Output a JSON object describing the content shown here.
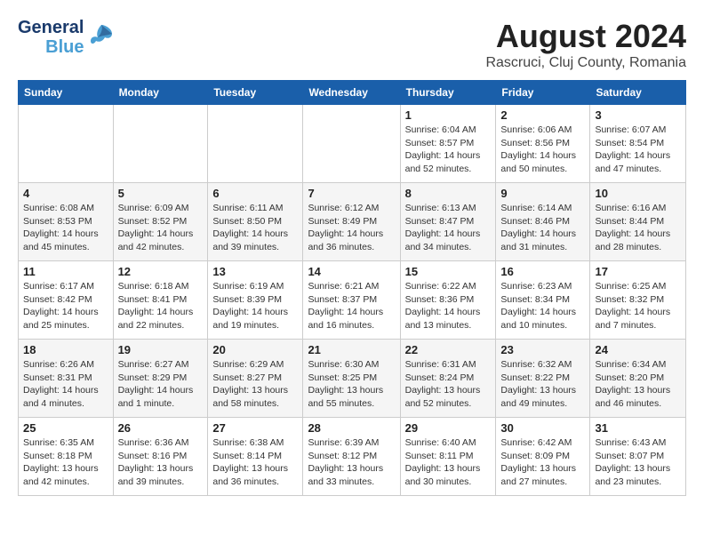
{
  "logo": {
    "line1": "General",
    "line2": "Blue"
  },
  "title": "August 2024",
  "location": "Rascruci, Cluj County, Romania",
  "days_of_week": [
    "Sunday",
    "Monday",
    "Tuesday",
    "Wednesday",
    "Thursday",
    "Friday",
    "Saturday"
  ],
  "weeks": [
    [
      {
        "day": "",
        "info": ""
      },
      {
        "day": "",
        "info": ""
      },
      {
        "day": "",
        "info": ""
      },
      {
        "day": "",
        "info": ""
      },
      {
        "day": "1",
        "info": "Sunrise: 6:04 AM\nSunset: 8:57 PM\nDaylight: 14 hours\nand 52 minutes."
      },
      {
        "day": "2",
        "info": "Sunrise: 6:06 AM\nSunset: 8:56 PM\nDaylight: 14 hours\nand 50 minutes."
      },
      {
        "day": "3",
        "info": "Sunrise: 6:07 AM\nSunset: 8:54 PM\nDaylight: 14 hours\nand 47 minutes."
      }
    ],
    [
      {
        "day": "4",
        "info": "Sunrise: 6:08 AM\nSunset: 8:53 PM\nDaylight: 14 hours\nand 45 minutes."
      },
      {
        "day": "5",
        "info": "Sunrise: 6:09 AM\nSunset: 8:52 PM\nDaylight: 14 hours\nand 42 minutes."
      },
      {
        "day": "6",
        "info": "Sunrise: 6:11 AM\nSunset: 8:50 PM\nDaylight: 14 hours\nand 39 minutes."
      },
      {
        "day": "7",
        "info": "Sunrise: 6:12 AM\nSunset: 8:49 PM\nDaylight: 14 hours\nand 36 minutes."
      },
      {
        "day": "8",
        "info": "Sunrise: 6:13 AM\nSunset: 8:47 PM\nDaylight: 14 hours\nand 34 minutes."
      },
      {
        "day": "9",
        "info": "Sunrise: 6:14 AM\nSunset: 8:46 PM\nDaylight: 14 hours\nand 31 minutes."
      },
      {
        "day": "10",
        "info": "Sunrise: 6:16 AM\nSunset: 8:44 PM\nDaylight: 14 hours\nand 28 minutes."
      }
    ],
    [
      {
        "day": "11",
        "info": "Sunrise: 6:17 AM\nSunset: 8:42 PM\nDaylight: 14 hours\nand 25 minutes."
      },
      {
        "day": "12",
        "info": "Sunrise: 6:18 AM\nSunset: 8:41 PM\nDaylight: 14 hours\nand 22 minutes."
      },
      {
        "day": "13",
        "info": "Sunrise: 6:19 AM\nSunset: 8:39 PM\nDaylight: 14 hours\nand 19 minutes."
      },
      {
        "day": "14",
        "info": "Sunrise: 6:21 AM\nSunset: 8:37 PM\nDaylight: 14 hours\nand 16 minutes."
      },
      {
        "day": "15",
        "info": "Sunrise: 6:22 AM\nSunset: 8:36 PM\nDaylight: 14 hours\nand 13 minutes."
      },
      {
        "day": "16",
        "info": "Sunrise: 6:23 AM\nSunset: 8:34 PM\nDaylight: 14 hours\nand 10 minutes."
      },
      {
        "day": "17",
        "info": "Sunrise: 6:25 AM\nSunset: 8:32 PM\nDaylight: 14 hours\nand 7 minutes."
      }
    ],
    [
      {
        "day": "18",
        "info": "Sunrise: 6:26 AM\nSunset: 8:31 PM\nDaylight: 14 hours\nand 4 minutes."
      },
      {
        "day": "19",
        "info": "Sunrise: 6:27 AM\nSunset: 8:29 PM\nDaylight: 14 hours\nand 1 minute."
      },
      {
        "day": "20",
        "info": "Sunrise: 6:29 AM\nSunset: 8:27 PM\nDaylight: 13 hours\nand 58 minutes."
      },
      {
        "day": "21",
        "info": "Sunrise: 6:30 AM\nSunset: 8:25 PM\nDaylight: 13 hours\nand 55 minutes."
      },
      {
        "day": "22",
        "info": "Sunrise: 6:31 AM\nSunset: 8:24 PM\nDaylight: 13 hours\nand 52 minutes."
      },
      {
        "day": "23",
        "info": "Sunrise: 6:32 AM\nSunset: 8:22 PM\nDaylight: 13 hours\nand 49 minutes."
      },
      {
        "day": "24",
        "info": "Sunrise: 6:34 AM\nSunset: 8:20 PM\nDaylight: 13 hours\nand 46 minutes."
      }
    ],
    [
      {
        "day": "25",
        "info": "Sunrise: 6:35 AM\nSunset: 8:18 PM\nDaylight: 13 hours\nand 42 minutes."
      },
      {
        "day": "26",
        "info": "Sunrise: 6:36 AM\nSunset: 8:16 PM\nDaylight: 13 hours\nand 39 minutes."
      },
      {
        "day": "27",
        "info": "Sunrise: 6:38 AM\nSunset: 8:14 PM\nDaylight: 13 hours\nand 36 minutes."
      },
      {
        "day": "28",
        "info": "Sunrise: 6:39 AM\nSunset: 8:12 PM\nDaylight: 13 hours\nand 33 minutes."
      },
      {
        "day": "29",
        "info": "Sunrise: 6:40 AM\nSunset: 8:11 PM\nDaylight: 13 hours\nand 30 minutes."
      },
      {
        "day": "30",
        "info": "Sunrise: 6:42 AM\nSunset: 8:09 PM\nDaylight: 13 hours\nand 27 minutes."
      },
      {
        "day": "31",
        "info": "Sunrise: 6:43 AM\nSunset: 8:07 PM\nDaylight: 13 hours\nand 23 minutes."
      }
    ]
  ]
}
